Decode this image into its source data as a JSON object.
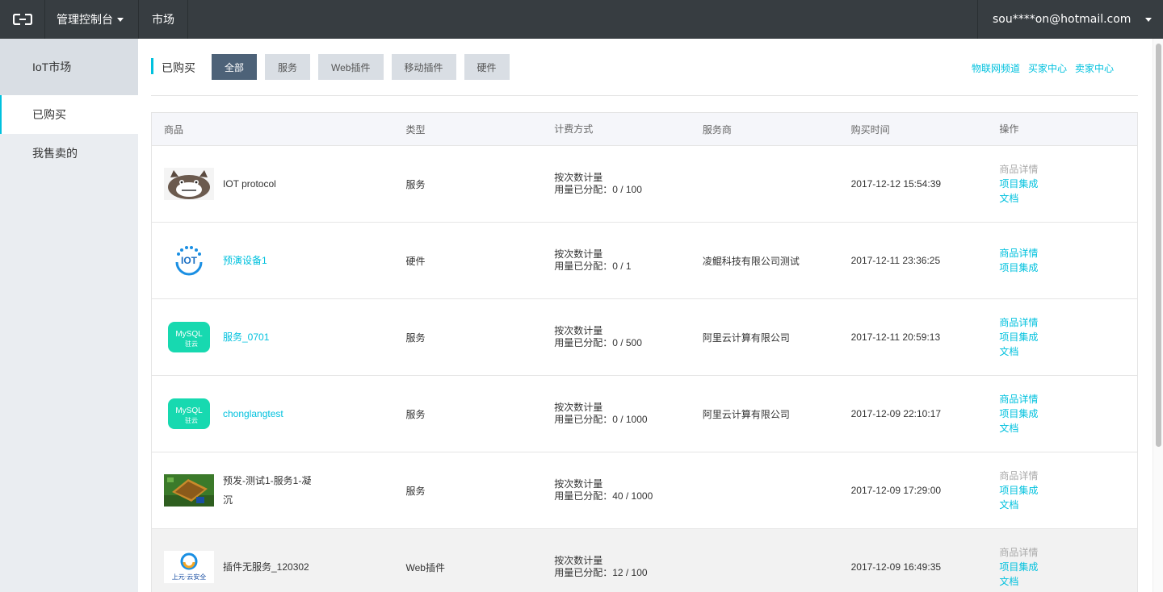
{
  "topbar": {
    "console_label": "管理控制台",
    "market_label": "市场",
    "user_email": "sou****on@hotmail.com"
  },
  "sidebar": {
    "title": "IoT市场",
    "items": [
      {
        "label": "已购买",
        "active": true
      },
      {
        "label": "我售卖的",
        "active": false
      }
    ]
  },
  "page": {
    "title": "已购买",
    "filters": [
      "全部",
      "服务",
      "Web插件",
      "移动插件",
      "硬件"
    ],
    "links": [
      "物联网频道",
      "买家中心",
      "卖家中心"
    ]
  },
  "table": {
    "headers": [
      "商品",
      "类型",
      "计费方式",
      "服务商",
      "购买时间",
      "操作"
    ],
    "rows": [
      {
        "name": "IOT protocol",
        "type": "服务",
        "billing": "按次数计量",
        "allocated": "用量已分配：0 / 100",
        "vendor": "",
        "time": "2017-12-12 15:54:39",
        "ops": [
          "商品详情",
          "项目集成",
          "文档"
        ]
      },
      {
        "name": "预演设备1",
        "type": "硬件",
        "billing": "按次数计量",
        "allocated": "用量已分配：0 / 1",
        "vendor": "凌鲲科技有限公司测试",
        "time": "2017-12-11 23:36:25",
        "ops": [
          "商品详情",
          "项目集成"
        ]
      },
      {
        "name": "服务_0701",
        "type": "服务",
        "billing": "按次数计量",
        "allocated": "用量已分配：0 / 500",
        "vendor": "阿里云计算有限公司",
        "time": "2017-12-11 20:59:13",
        "ops": [
          "商品详情",
          "项目集成",
          "文档"
        ]
      },
      {
        "name": "chonglangtest",
        "type": "服务",
        "billing": "按次数计量",
        "allocated": "用量已分配：0 / 1000",
        "vendor": "阿里云计算有限公司",
        "time": "2017-12-09 22:10:17",
        "ops": [
          "商品详情",
          "项目集成",
          "文档"
        ]
      },
      {
        "name": "预发-测试1-服务1-凝沉",
        "type": "服务",
        "billing": "按次数计量",
        "allocated": "用量已分配：40 / 1000",
        "vendor": "",
        "time": "2017-12-09 17:29:00",
        "ops": [
          "商品详情",
          "项目集成",
          "文档"
        ]
      },
      {
        "name": "插件无服务_120302",
        "type": "Web插件",
        "billing": "按次数计量",
        "allocated": "用量已分配：12 / 100",
        "vendor": "",
        "time": "2017-12-09 16:49:35",
        "ops": [
          "商品详情",
          "项目集成",
          "文档"
        ]
      }
    ],
    "logo_texts": {
      "iot": "IOT",
      "mysql": "MySQL",
      "mysql_sub": "驻云",
      "security": "上元·云安全"
    }
  },
  "colors": {
    "accent": "#00c1de",
    "topbar": "#373d41",
    "sidebar": "#eaedf1",
    "filter_active": "#4d6278"
  }
}
